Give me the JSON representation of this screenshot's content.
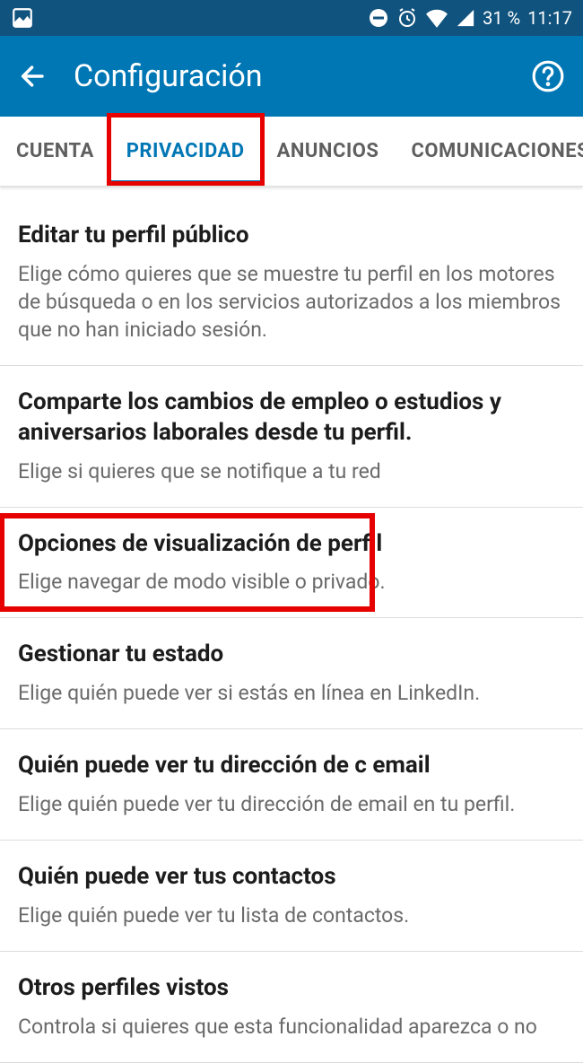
{
  "statusBar": {
    "battery": "31 %",
    "time": "11:17"
  },
  "appBar": {
    "title": "Configuración"
  },
  "tabs": [
    {
      "label": "CUENTA",
      "active": false,
      "highlighted": false
    },
    {
      "label": "PRIVACIDAD",
      "active": true,
      "highlighted": true
    },
    {
      "label": "ANUNCIOS",
      "active": false,
      "highlighted": false
    },
    {
      "label": "COMUNICACIONES",
      "active": false,
      "highlighted": false
    }
  ],
  "settings": [
    {
      "title": "Editar tu perfil público",
      "subtitle": "Elige cómo quieres que se muestre tu perfil en los motores de búsqueda o en los servicios autorizados a los miembros que no han iniciado sesión.",
      "highlighted": false
    },
    {
      "title": "Comparte los cambios de empleo o estudios y aniversarios laborales desde tu perfil.",
      "subtitle": "Elige si quieres que se notifique a tu red",
      "highlighted": false
    },
    {
      "title": "Opciones de visualización de perfil",
      "subtitle": "Elige navegar de modo visible o privado.",
      "highlighted": true
    },
    {
      "title": "Gestionar tu estado",
      "subtitle": "Elige quién puede ver si estás en línea en LinkedIn.",
      "highlighted": false
    },
    {
      "title": "Quién puede ver tu dirección de c email",
      "subtitle": "Elige quién puede ver tu dirección de email en tu perfil.",
      "highlighted": false
    },
    {
      "title": "Quién puede ver tus contactos",
      "subtitle": "Elige quién puede ver tu lista de contactos.",
      "highlighted": false
    },
    {
      "title": "Otros perfiles vistos",
      "subtitle": "Controla si quieres que esta funcionalidad aparezca o no",
      "highlighted": false
    }
  ]
}
